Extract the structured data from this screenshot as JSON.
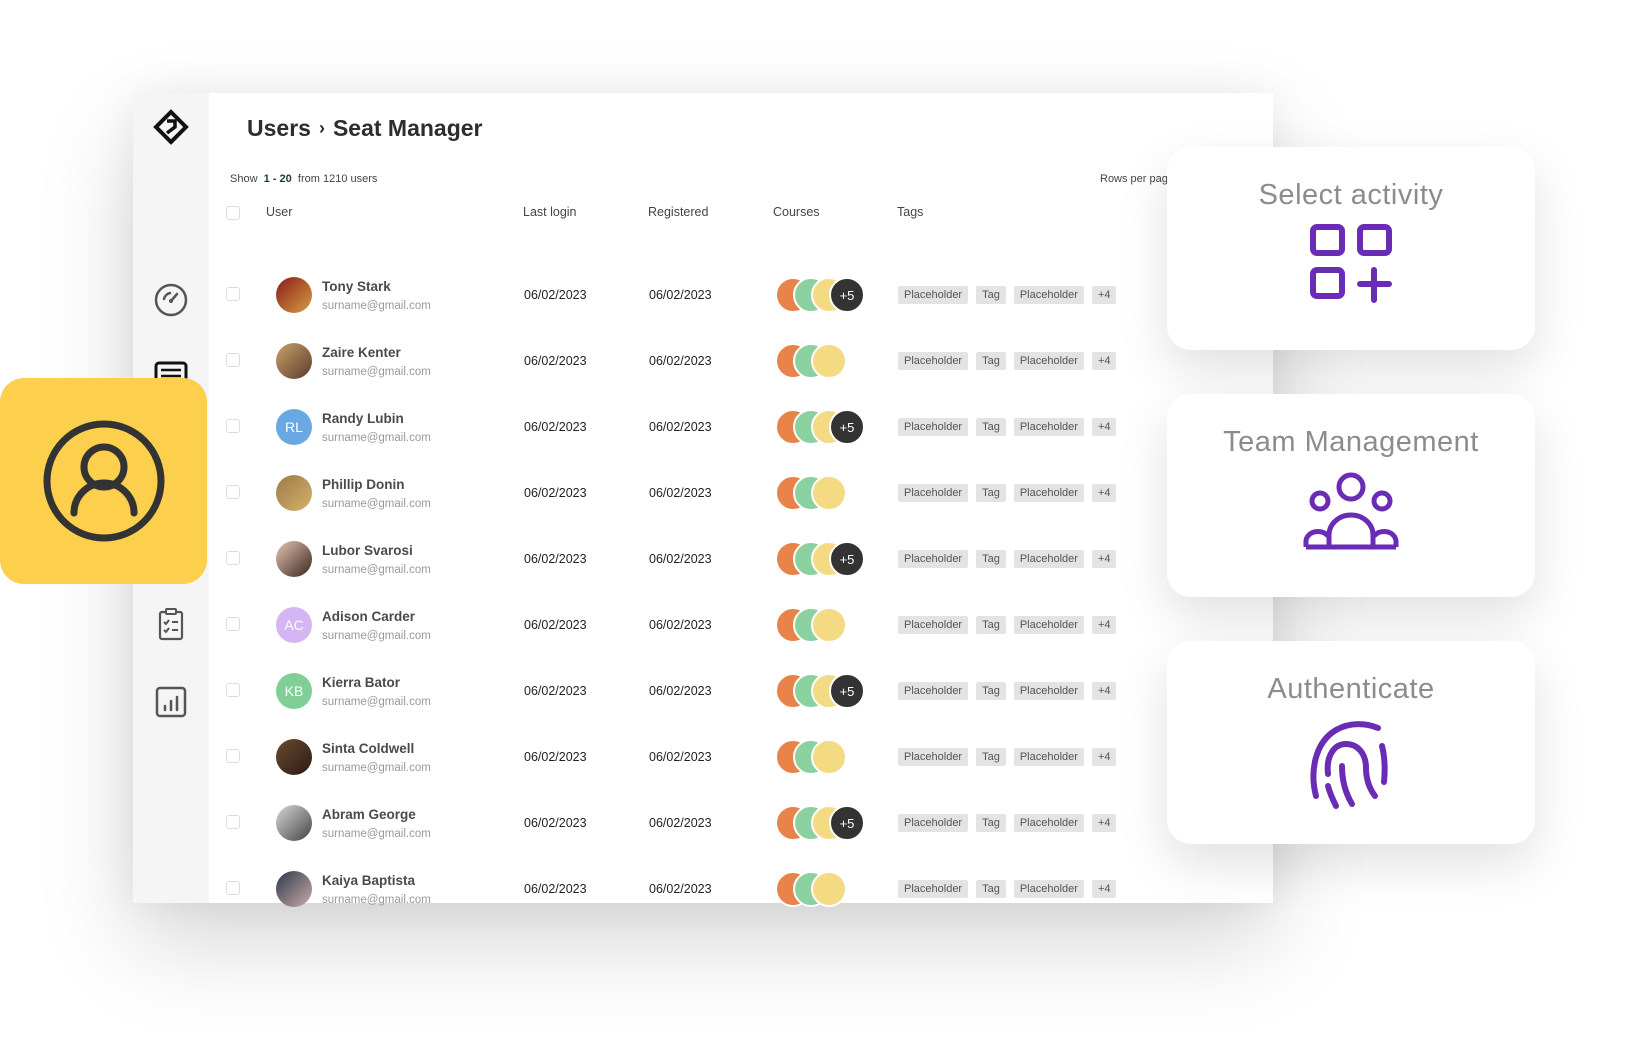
{
  "breadcrumb": {
    "parent": "Users",
    "current": "Seat Manager"
  },
  "summary": {
    "show": "Show",
    "range": "1 - 20",
    "from": "from 1210 users"
  },
  "rows_per_page": "Rows per page",
  "columns": {
    "user": "User",
    "last_login": "Last login",
    "registered": "Registered",
    "courses": "Courses",
    "tags": "Tags"
  },
  "colors": {
    "course1": "#e8844a",
    "course2": "#8bd1a0",
    "course3": "#f5da84",
    "more": "#333333",
    "accent": "#6a2bb5",
    "highlight": "#fcd04d"
  },
  "rows": [
    {
      "name": "Tony Stark",
      "email": "surname@gmail.com",
      "last_login": "06/02/2023",
      "registered": "06/02/2023",
      "more_courses": "+5",
      "avatar": "photo"
    },
    {
      "name": "Zaire Kenter",
      "email": "surname@gmail.com",
      "last_login": "06/02/2023",
      "registered": "06/02/2023",
      "more_courses": "",
      "avatar": "photo"
    },
    {
      "name": "Randy Lubin",
      "email": "surname@gmail.com",
      "last_login": "06/02/2023",
      "registered": "06/02/2023",
      "more_courses": "+5",
      "avatar": "RL",
      "avatar_color": "#6aa8e3"
    },
    {
      "name": "Phillip Donin",
      "email": "surname@gmail.com",
      "last_login": "06/02/2023",
      "registered": "06/02/2023",
      "more_courses": "",
      "avatar": "photo"
    },
    {
      "name": "Lubor Svarosi",
      "email": "surname@gmail.com",
      "last_login": "06/02/2023",
      "registered": "06/02/2023",
      "more_courses": "+5",
      "avatar": "photo"
    },
    {
      "name": "Adison Carder",
      "email": "surname@gmail.com",
      "last_login": "06/02/2023",
      "registered": "06/02/2023",
      "more_courses": "",
      "avatar": "AC",
      "avatar_color": "#d4b6f5"
    },
    {
      "name": "Kierra Bator",
      "email": "surname@gmail.com",
      "last_login": "06/02/2023",
      "registered": "06/02/2023",
      "more_courses": "+5",
      "avatar": "KB",
      "avatar_color": "#7fcf96"
    },
    {
      "name": "Sinta Coldwell",
      "email": "surname@gmail.com",
      "last_login": "06/02/2023",
      "registered": "06/02/2023",
      "more_courses": "",
      "avatar": "photo"
    },
    {
      "name": "Abram George",
      "email": "surname@gmail.com",
      "last_login": "06/02/2023",
      "registered": "06/02/2023",
      "more_courses": "+5",
      "avatar": "photo"
    },
    {
      "name": "Kaiya Baptista",
      "email": "surname@gmail.com",
      "last_login": "06/02/2023",
      "registered": "06/02/2023",
      "more_courses": "",
      "avatar": "photo"
    }
  ],
  "tags": [
    "Placeholder",
    "Tag",
    "Placeholder",
    "+4"
  ],
  "cards": [
    {
      "title": "Select activity",
      "icon": "add-grid-icon"
    },
    {
      "title": "Team Management",
      "icon": "team-icon"
    },
    {
      "title": "Authenticate",
      "icon": "fingerprint-icon"
    }
  ]
}
